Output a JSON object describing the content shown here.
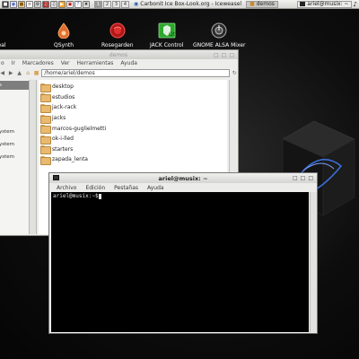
{
  "panel": {
    "workspaces": [
      "1",
      "2",
      "3",
      "4"
    ],
    "active_workspace": 0,
    "tasks": [
      {
        "label": "Carbonit Ice Box-Look.org - Iceweasel",
        "icon": "globe-icon",
        "pressed": false
      },
      {
        "label": "demos",
        "icon": "folder-icon",
        "pressed": true
      }
    ],
    "tray": {
      "user_host": "ariel@musix: ~"
    }
  },
  "desktop_icons": [
    {
      "label": "eal",
      "icon": "app-icon"
    },
    {
      "label": "QSynth",
      "icon": "qsynth-icon"
    },
    {
      "label": "Rosegarden",
      "icon": "rosegarden-icon"
    },
    {
      "label": "JACK Control",
      "icon": "jack-icon"
    },
    {
      "label": "GNOME ALSA Mixer",
      "icon": "mixer-icon"
    }
  ],
  "file_manager": {
    "title": "demos",
    "menu": [
      "o",
      "Ir",
      "Marcadores",
      "Ver",
      "Herramientas",
      "Ayuda"
    ],
    "location": "/home/ariel/demos",
    "sidebar": [
      "s",
      "",
      "ystem",
      "ystem",
      "ystem"
    ],
    "files": [
      "desktop",
      "estudios",
      "jack-rack",
      "jacks",
      "marcos-guglielmetti",
      "ok-i-lled",
      "starters",
      "zapada_lenta"
    ]
  },
  "terminal": {
    "title": "ariel@musix: ~",
    "menu": [
      "Archivo",
      "Edición",
      "Pestañas",
      "Ayuda"
    ],
    "prompt": "ariel@musix:~$"
  }
}
